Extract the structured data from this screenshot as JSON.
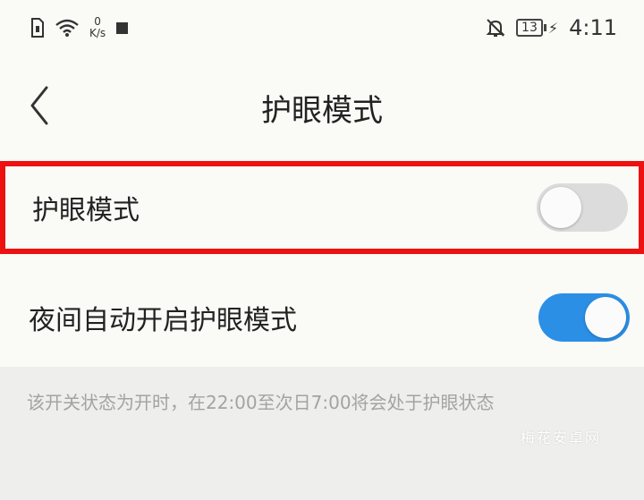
{
  "status_bar": {
    "net_speed_value": "0",
    "net_speed_unit": "K/s",
    "battery_level": "13",
    "time": "4:11",
    "icons": [
      "sim-icon",
      "wifi-icon",
      "notification-square-icon",
      "mute-bell-icon",
      "battery-icon",
      "charging-bolt-icon"
    ]
  },
  "header": {
    "title": "护眼模式"
  },
  "settings": [
    {
      "label": "护眼模式",
      "toggle_on": false,
      "highlight_color": "#ee1111"
    },
    {
      "label": "夜间自动开启护眼模式",
      "toggle_on": true
    }
  ],
  "note": "该开关状态为开时，在22:00至次日7:00将会处于护眼状态",
  "watermark": "梅花安卓网",
  "colors": {
    "toggle_on": "#2b8fe6",
    "toggle_off": "#dcdcdc",
    "highlight": "#ee1111"
  }
}
